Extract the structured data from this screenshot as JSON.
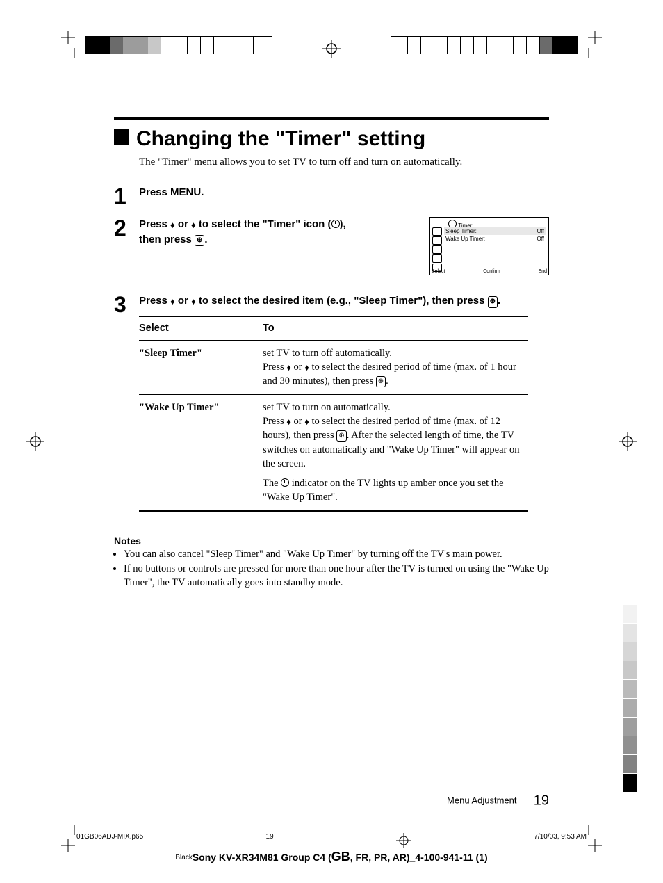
{
  "header": {
    "title": "Changing the \"Timer\" setting"
  },
  "intro": "The \"Timer\" menu allows you to set TV to turn off and turn on automatically.",
  "steps": {
    "s1": {
      "num": "1",
      "text": "Press MENU."
    },
    "s2": {
      "num": "2",
      "text_a": "Press ",
      "text_b": " or ",
      "text_c": " to select the \"Timer\" icon (",
      "text_d": "),",
      "text_e": "then press ",
      "text_f": "."
    },
    "s3": {
      "num": "3",
      "text_a": "Press ",
      "text_b": " or ",
      "text_c": " to select the desired item (e.g., \"Sleep Timer\"), then press ",
      "text_d": "."
    }
  },
  "osd": {
    "title": "Timer",
    "row1": {
      "label": "Sleep Timer:",
      "value": "Off"
    },
    "row2": {
      "label": "Wake Up Timer:",
      "value": "Off"
    },
    "foot1": "Select",
    "foot2": "Confirm",
    "foot3": "End"
  },
  "table": {
    "h1": "Select",
    "h2": "To",
    "r1": {
      "c1": "\"Sleep Timer\"",
      "p1": "set TV to turn off automatically.",
      "p2a": "Press ",
      "p2b": " or ",
      "p2c": " to select the desired period of time (max. of 1 hour and 30 minutes), then press ",
      "p2d": "."
    },
    "r2": {
      "c1": "\"Wake Up Timer\"",
      "p1": "set TV to turn on automatically.",
      "p2a": "Press ",
      "p2b": " or ",
      "p2c": " to select the desired period of time (max. of 12 hours), then press ",
      "p2d": ".  After the selected length of time, the TV switches on automatically and \"Wake Up Timer\" will appear on the screen.",
      "p3a": "The ",
      "p3b": " indicator on the TV lights up amber once you set the \"Wake Up Timer\"."
    }
  },
  "notes": {
    "heading": "Notes",
    "n1": "You can also cancel \"Sleep Timer\" and \"Wake Up Timer\" by turning off the TV's main power.",
    "n2": "If no buttons or controls are pressed for more than one hour after the TV is turned on using the \"Wake Up Timer\", the TV automatically goes into standby mode."
  },
  "footer": {
    "section": "Menu Adjustment",
    "page": "19",
    "src_file": "01GB06ADJ-MIX.p65",
    "src_page": "19",
    "src_date": "7/10/03, 9:53 AM",
    "color": "Black",
    "product": "Sony KV-XR34M81 Group C4 (",
    "gb": "GB",
    "product_tail": ", FR, PR, AR)_4-100-941-11 (1)"
  }
}
